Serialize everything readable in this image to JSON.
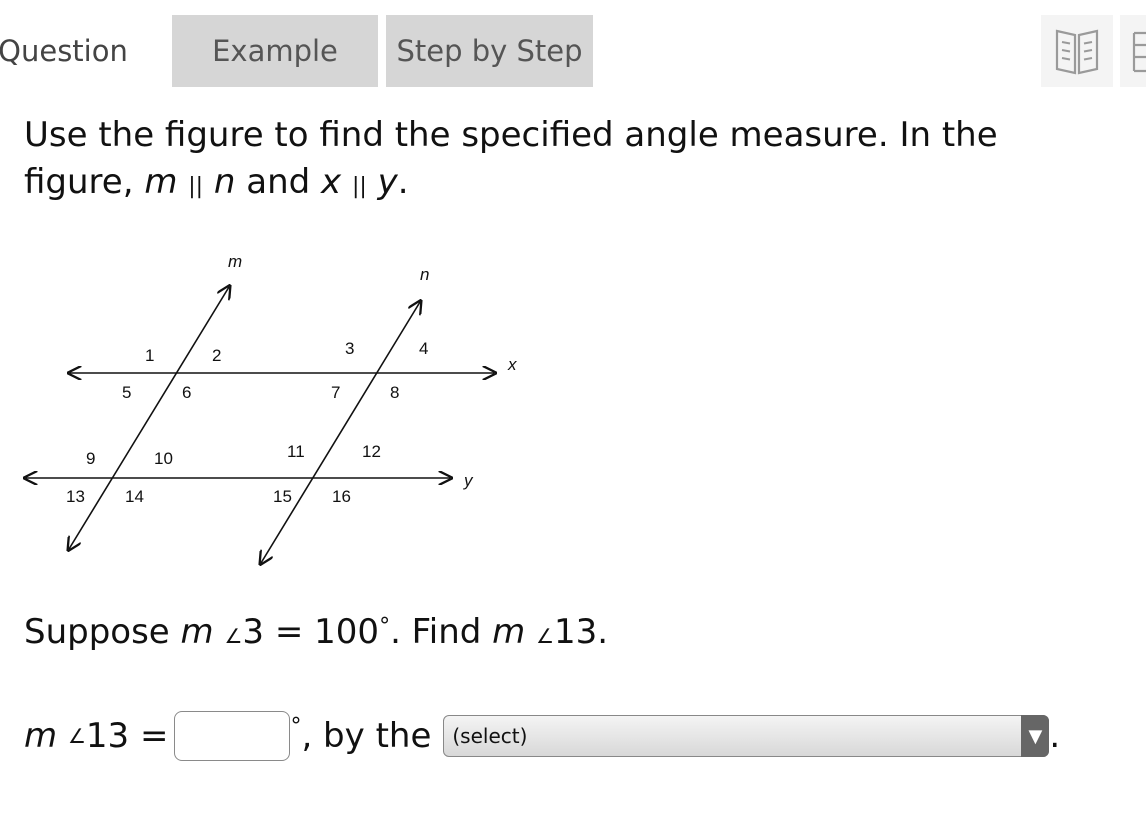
{
  "tabs": {
    "question": "Question",
    "example": "Example",
    "step_by_step": "Step by Step"
  },
  "prompt": {
    "line1": "Use the figure to find the specified angle measure. In the",
    "line2_start": "figure, ",
    "var_m": "m",
    "parallel": "||",
    "var_n": "n",
    "and_word": " and ",
    "var_x": "x",
    "var_y": "y",
    "end": "."
  },
  "figure": {
    "line_labels": {
      "m": "m",
      "n": "n",
      "x": "x",
      "y": "y"
    },
    "angle_labels": [
      "1",
      "2",
      "3",
      "4",
      "5",
      "6",
      "7",
      "8",
      "9",
      "10",
      "11",
      "12",
      "13",
      "14",
      "15",
      "16"
    ]
  },
  "question": {
    "suppose": "Suppose ",
    "m": "m",
    "angle_symbol": "∠",
    "given_angle": "3 = 100",
    "degree": "°",
    "find": ". Find ",
    "target_angle": "13."
  },
  "answer": {
    "m": "m",
    "angle_symbol": "∠",
    "label": "13 =",
    "input_value": "",
    "degree": "°",
    "by_the": ", by the",
    "select_value": "(select)",
    "select_arrow": "▼",
    "end": "."
  },
  "icons": [
    "book-icon",
    "partial-icon"
  ]
}
